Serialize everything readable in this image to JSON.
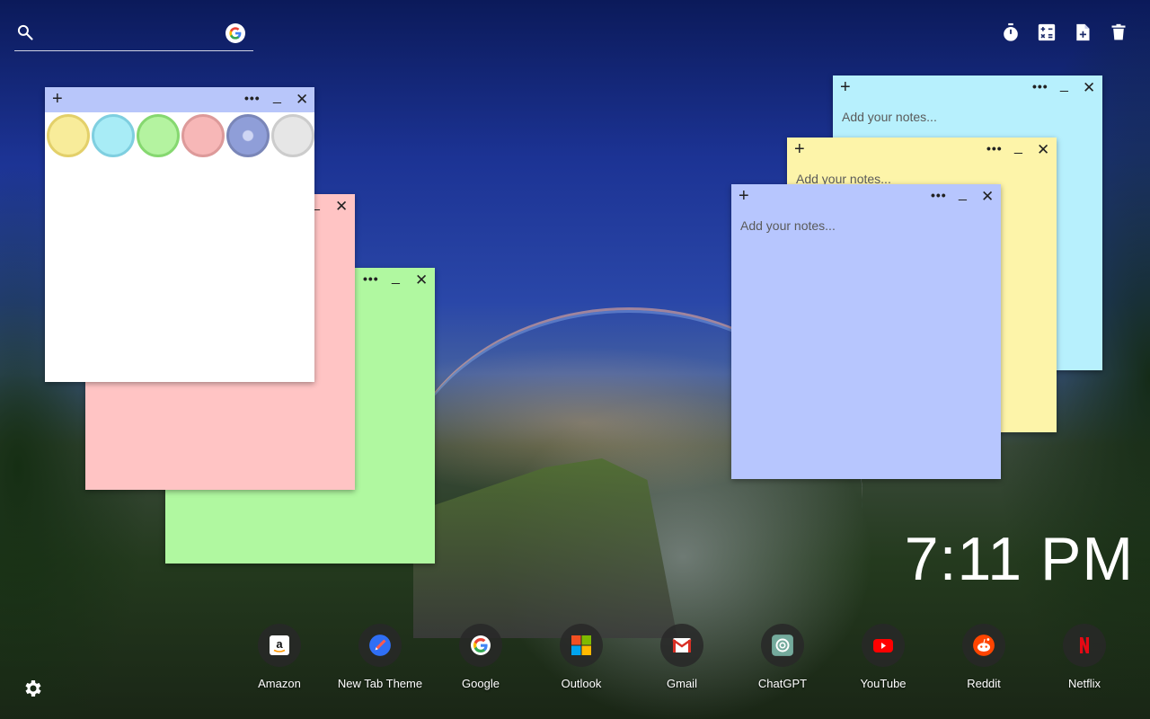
{
  "search": {
    "placeholder": ""
  },
  "toolbar": {
    "tools": [
      {
        "name": "timer-icon"
      },
      {
        "name": "calculator-icon"
      },
      {
        "name": "add-note-icon"
      },
      {
        "name": "delete-icon"
      }
    ]
  },
  "notes": {
    "placeholder": "Add your notes...",
    "color_picker": [
      "#f8ec9a",
      "#a8ecf6",
      "#b4f3a0",
      "#f7b7b7",
      "#8f9ed8",
      "#e6e6e6"
    ],
    "items": [
      {
        "color": "#b0f8a0",
        "value": ""
      },
      {
        "color": "#ffc4c4",
        "value": ""
      },
      {
        "color": "#ffffff",
        "bar_color": "#b8c6fa",
        "value": ""
      },
      {
        "color": "#b7f0fd",
        "value": ""
      },
      {
        "color": "#fdf4a9",
        "value": ""
      },
      {
        "color": "#b7c6fe",
        "value": ""
      }
    ],
    "bar_glyphs": {
      "add": "+",
      "more": "•••",
      "minimize": "_",
      "close": "✕"
    }
  },
  "clock": {
    "time": "7:11 PM"
  },
  "shortcuts": [
    {
      "label": "Amazon",
      "icon": "amazon-icon"
    },
    {
      "label": "New Tab Theme",
      "icon": "new-tab-theme-icon"
    },
    {
      "label": "Google",
      "icon": "google-icon"
    },
    {
      "label": "Outlook",
      "icon": "outlook-icon"
    },
    {
      "label": "Gmail",
      "icon": "gmail-icon"
    },
    {
      "label": "ChatGPT",
      "icon": "chatgpt-icon"
    },
    {
      "label": "YouTube",
      "icon": "youtube-icon"
    },
    {
      "label": "Reddit",
      "icon": "reddit-icon"
    },
    {
      "label": "Netflix",
      "icon": "netflix-icon"
    }
  ]
}
